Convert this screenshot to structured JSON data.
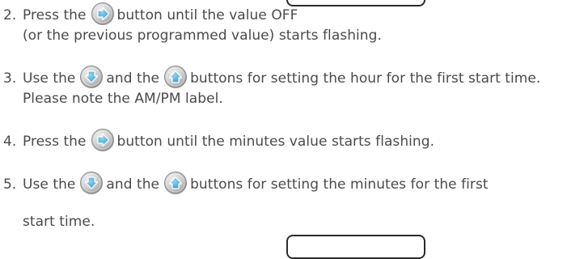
{
  "steps": [
    {
      "number": "2.",
      "before": "Press the",
      "icon": "right-arrow-button-icon",
      "after": "button until the value OFF",
      "line2": "(or the previous programmed value) starts flashing."
    },
    {
      "number": "3.",
      "before": "Use the",
      "icon1": "down-arrow-button-icon",
      "middle": "and the",
      "icon2": "up-arrow-button-icon",
      "after": "buttons for setting the hour for the first start time.",
      "line2": "Please note the AM/PM label."
    },
    {
      "number": "4.",
      "before": "Press the",
      "icon": "right-arrow-button-icon",
      "after": "button until the minutes value starts flashing."
    },
    {
      "number": "5.",
      "before": "Use the",
      "icon1": "down-arrow-button-icon",
      "middle": "and the",
      "icon2": "up-arrow-button-icon",
      "after": "buttons for setting the minutes for the first",
      "line2": "start time."
    }
  ],
  "colors": {
    "text": "#4a4a4a",
    "button_fill_light": "#e6e6e6",
    "button_fill_dark": "#9a9a9a",
    "button_arrow": "#4fb0dc",
    "display_border": "#2b2b2b"
  }
}
